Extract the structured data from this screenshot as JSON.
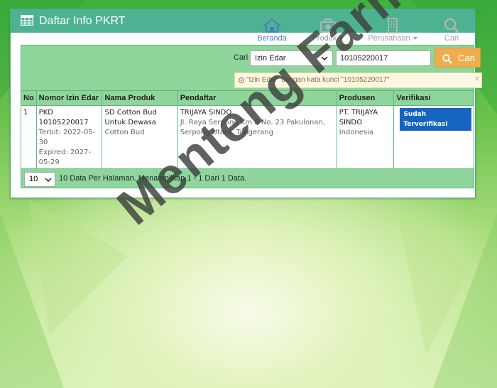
{
  "header": {
    "title": "Daftar Info PKRT",
    "nav": [
      {
        "label": "Beranda",
        "icon": "home-icon",
        "dropdown": false
      },
      {
        "label": "Produk",
        "icon": "medkit-icon",
        "dropdown": true
      },
      {
        "label": "Perusahaan",
        "icon": "building-icon",
        "dropdown": true
      },
      {
        "label": "Cari",
        "icon": "search-icon",
        "dropdown": false
      }
    ]
  },
  "search": {
    "label": "Cari",
    "field": "Izin Edar",
    "value": "10105220017",
    "button": "Cari",
    "alert": "\"Izin Edar\" dengan kata kunci \"10105220017\"",
    "alert_close": "×"
  },
  "table": {
    "headers": [
      "No",
      "Nomor Izin Edar",
      "Nama Produk",
      "Pendaftar",
      "Produsen",
      "Verifikasi"
    ],
    "rows": [
      {
        "no": "1",
        "izin_code": "PKD",
        "izin_number": "10105220017",
        "terbit": "Terbit: 2022-05-30",
        "expired": "Expired: 2027-05-29",
        "produk_nama": "SD Cotton Bud Untuk Dewasa",
        "produk_merek": "Cotton Bud",
        "pendaftar_nama": "TRIJAYA SINDO",
        "pendaftar_alamat": "Jl. Raya Serpong Km 8 No. 23 Pakulonan, Serpong Utara, Tangerang",
        "produsen_nama": "PT. TRIJAYA SINDO",
        "produsen_negara": "Indonesia",
        "verifikasi": "Sudah Terverifikasi"
      }
    ]
  },
  "footer": {
    "per_page": "10",
    "info": "10 Data Per Halaman. Menampilkan 1 - 1 Dari 1 Data."
  },
  "watermark": "Menteng Farma",
  "colors": {
    "header_bg": "#4db291",
    "panel_green": "#8fd69c",
    "button_orange": "#f0ad4e",
    "badge_blue": "#1565c0",
    "alert_bg": "#fcf8e3"
  }
}
